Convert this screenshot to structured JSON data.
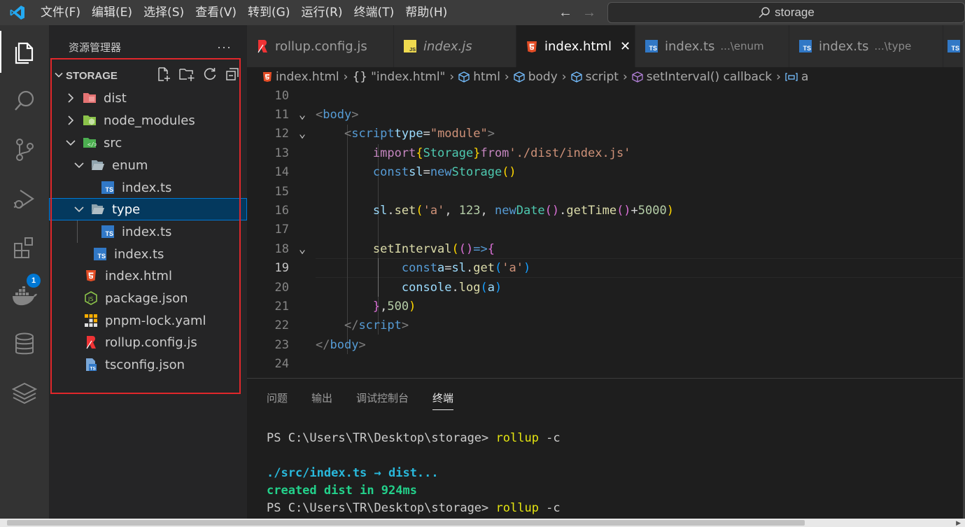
{
  "menu": [
    "文件(F)",
    "编辑(E)",
    "选择(S)",
    "查看(V)",
    "转到(G)",
    "运行(R)",
    "终端(T)",
    "帮助(H)"
  ],
  "search": {
    "text": "storage"
  },
  "activity": {
    "extensions_badge": "1"
  },
  "sidebar": {
    "title": "资源管理器",
    "more": "···",
    "folder": "STORAGE",
    "tree": [
      {
        "label": "dist"
      },
      {
        "label": "node_modules"
      },
      {
        "label": "src"
      },
      {
        "label": "enum"
      },
      {
        "label": "index.ts"
      },
      {
        "label": "type"
      },
      {
        "label": "index.ts"
      },
      {
        "label": "index.ts"
      },
      {
        "label": "index.html"
      },
      {
        "label": "package.json"
      },
      {
        "label": "pnpm-lock.yaml"
      },
      {
        "label": "rollup.config.js"
      },
      {
        "label": "tsconfig.json"
      }
    ]
  },
  "tabs": [
    {
      "label": "rollup.config.js",
      "desc": ""
    },
    {
      "label": "index.js",
      "desc": ""
    },
    {
      "label": "index.html",
      "desc": ""
    },
    {
      "label": "index.ts",
      "desc": "...\\enum"
    },
    {
      "label": "index.ts",
      "desc": "...\\type"
    }
  ],
  "breadcrumb": [
    "index.html",
    "\"index.html\"",
    "html",
    "body",
    "script",
    "setInterval() callback",
    "a"
  ],
  "code": {
    "line_numbers": [
      "10",
      "11",
      "12",
      "13",
      "14",
      "15",
      "16",
      "17",
      "18",
      "19",
      "20",
      "21",
      "22",
      "23",
      "24"
    ]
  },
  "panel": {
    "tabs": [
      "问题",
      "输出",
      "调试控制台",
      "终端"
    ],
    "terminal": {
      "prompt1": "PS C:\\Users\\TR\\Desktop\\storage> ",
      "cmd1": "rollup",
      "flag1": " -c",
      "build_line": "./src/index.ts → dist...",
      "created_prefix": "created ",
      "created_target": "dist",
      "created_suffix": " in ",
      "created_time": "924ms",
      "prompt2": "PS C:\\Users\\TR\\Desktop\\storage> ",
      "cmd2": "rollup",
      "flag2": " -c"
    }
  }
}
